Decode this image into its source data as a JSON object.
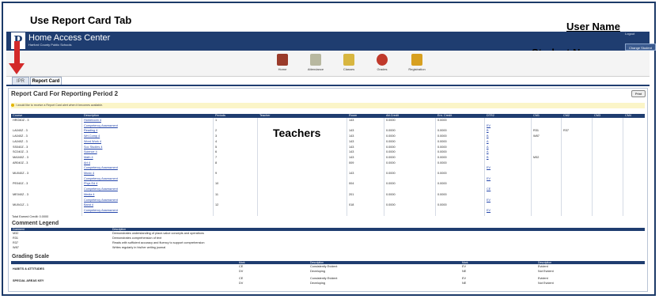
{
  "annotations": {
    "tab_label": "Use Report Card Tab",
    "user_name": "User Name",
    "student_name": "Student Name",
    "teachers": "Teachers"
  },
  "header": {
    "logo_letter": "P",
    "title": "Home Access Center",
    "subtitle": "Harford County Public Schools",
    "logout": "Logout",
    "change_student": "Change Student"
  },
  "nav": {
    "items": [
      {
        "label": "Home",
        "color": "#9a3b2a"
      },
      {
        "label": "Attendance",
        "color": "#b8b8a0"
      },
      {
        "label": "Classes",
        "color": "#d8b640"
      },
      {
        "label": "Grades",
        "color": "#c0392b"
      },
      {
        "label": "Registration",
        "color": "#d8a020"
      }
    ]
  },
  "tabs": {
    "inactive": "IPR",
    "active": "Report Card"
  },
  "report": {
    "heading": "Report Card For Reporting Period 2",
    "print": "Print",
    "notice": "I would like to receive a Report Card alert when it becomes available.",
    "columns": [
      "Course",
      "Description",
      "Periods",
      "Teacher",
      "Room",
      "Att.Credit",
      "Ern. Credit",
      "DTR2",
      "CM1",
      "CM2",
      "CM3",
      "CM4"
    ],
    "rows": [
      {
        "course": "HRO40Z - 3",
        "desc": "Homeroom 4",
        "period": "1",
        "room": "143",
        "att": "0.0000",
        "ern": "0.0000",
        "dtr": "",
        "cm1": "",
        "cm2": ""
      },
      {
        "course": "",
        "desc": "Competency Assessment",
        "period": "",
        "room": "",
        "att": "",
        "ern": "",
        "dtr": "EV",
        "cm1": "",
        "cm2": ""
      },
      {
        "course": "LA040Z - 3",
        "desc": "Reading 4",
        "period": "2",
        "room": "143",
        "att": "0.0000",
        "ern": "0.0000",
        "dtr": "B",
        "cm1": "R31",
        "cm2": "R37"
      },
      {
        "course": "LA040Z - 3",
        "desc": "Wrt Comp 4",
        "period": "3",
        "room": "143",
        "att": "0.0000",
        "ern": "0.0000",
        "dtr": "B",
        "cm1": "W87",
        "cm2": ""
      },
      {
        "course": "LA040Z - 3",
        "desc": "Word Work 4",
        "period": "4",
        "room": "143",
        "att": "0.0000",
        "ern": "0.0000",
        "dtr": "A",
        "cm1": "",
        "cm2": ""
      },
      {
        "course": "SS040Z - 3",
        "desc": "Soc Studies 4",
        "period": "5",
        "room": "143",
        "att": "0.0000",
        "ern": "0.0000",
        "dtr": "A",
        "cm1": "",
        "cm2": ""
      },
      {
        "course": "SC040Z - 3",
        "desc": "Science 4",
        "period": "6",
        "room": "143",
        "att": "0.0000",
        "ern": "0.0000",
        "dtr": "A",
        "cm1": "",
        "cm2": ""
      },
      {
        "course": "MA040Z - 3",
        "desc": "Math 4",
        "period": "7",
        "room": "143",
        "att": "0.0000",
        "ern": "0.0000",
        "dtr": "B",
        "cm1": "M32",
        "cm2": ""
      },
      {
        "course": "AR040Z - 3",
        "desc": "Art 4",
        "period": "8",
        "room": "009",
        "att": "0.0000",
        "ern": "0.0000",
        "dtr": "",
        "cm1": "",
        "cm2": ""
      },
      {
        "course": "",
        "desc": "Competency Assessment",
        "period": "",
        "room": "",
        "att": "",
        "ern": "",
        "dtr": "EV",
        "cm1": "",
        "cm2": ""
      },
      {
        "course": "MU040Z - 3",
        "desc": "Music 4",
        "period": "9",
        "room": "143",
        "att": "0.0000",
        "ern": "0.0000",
        "dtr": "",
        "cm1": "",
        "cm2": ""
      },
      {
        "course": "",
        "desc": "Competency Assessment",
        "period": "",
        "room": "",
        "att": "",
        "ern": "",
        "dtr": "EV",
        "cm1": "",
        "cm2": ""
      },
      {
        "course": "PE040Z - 3",
        "desc": "Phys Ed 4",
        "period": "10",
        "room": "004",
        "att": "0.0000",
        "ern": "0.0000",
        "dtr": "",
        "cm1": "",
        "cm2": ""
      },
      {
        "course": "",
        "desc": "Competency Assessment",
        "period": "",
        "room": "",
        "att": "",
        "ern": "",
        "dtr": "CE",
        "cm1": "",
        "cm2": ""
      },
      {
        "course": "ME040Z - 3",
        "desc": "Media 4",
        "period": "11",
        "room": "201",
        "att": "0.0000",
        "ern": "0.0000",
        "dtr": "",
        "cm1": "",
        "cm2": ""
      },
      {
        "course": "",
        "desc": "Competency Assessment",
        "period": "",
        "room": "",
        "att": "",
        "ern": "",
        "dtr": "EV",
        "cm1": "",
        "cm2": ""
      },
      {
        "course": "MU041Z - 1",
        "desc": "Band 4",
        "period": "12",
        "room": "018",
        "att": "0.0000",
        "ern": "0.0000",
        "dtr": "",
        "cm1": "",
        "cm2": ""
      },
      {
        "course": "",
        "desc": "Competency Assessment",
        "period": "",
        "room": "",
        "att": "",
        "ern": "",
        "dtr": "EV",
        "cm1": "",
        "cm2": ""
      }
    ],
    "total": "Total Earned Credit: 0.0000"
  },
  "legend": {
    "title": "Comment Legend",
    "columns": [
      "Comment",
      "Description"
    ],
    "rows": [
      {
        "code": "M32",
        "desc": "Demonstrates understanding of place-value concepts and operations"
      },
      {
        "code": "R31",
        "desc": "Demonstrates comprehension of text"
      },
      {
        "code": "R37",
        "desc": "Reads with sufficient accuracy and fluency to support comprehension"
      },
      {
        "code": "W87",
        "desc": "Writes regularly in his/her writing journal"
      }
    ]
  },
  "grading": {
    "title": "Grading Scale",
    "columns": [
      "Mark",
      "Description",
      "Mark",
      "Description"
    ],
    "groups": [
      {
        "name": "HABITS & ATTITUDES",
        "rows": [
          {
            "m1": "CE",
            "d1": "Consistently Evident",
            "m2": "EV",
            "d2": "Evident"
          },
          {
            "m1": "DV",
            "d1": "Developing",
            "m2": "NE",
            "d2": "Not Evident"
          }
        ]
      },
      {
        "name": "SPECIAL AREAS KEY",
        "rows": [
          {
            "m1": "CE",
            "d1": "Consistently Evident",
            "m2": "EV",
            "d2": "Evident"
          },
          {
            "m1": "DV",
            "d1": "Developing",
            "m2": "NE",
            "d2": "Not Evident"
          }
        ]
      }
    ]
  }
}
